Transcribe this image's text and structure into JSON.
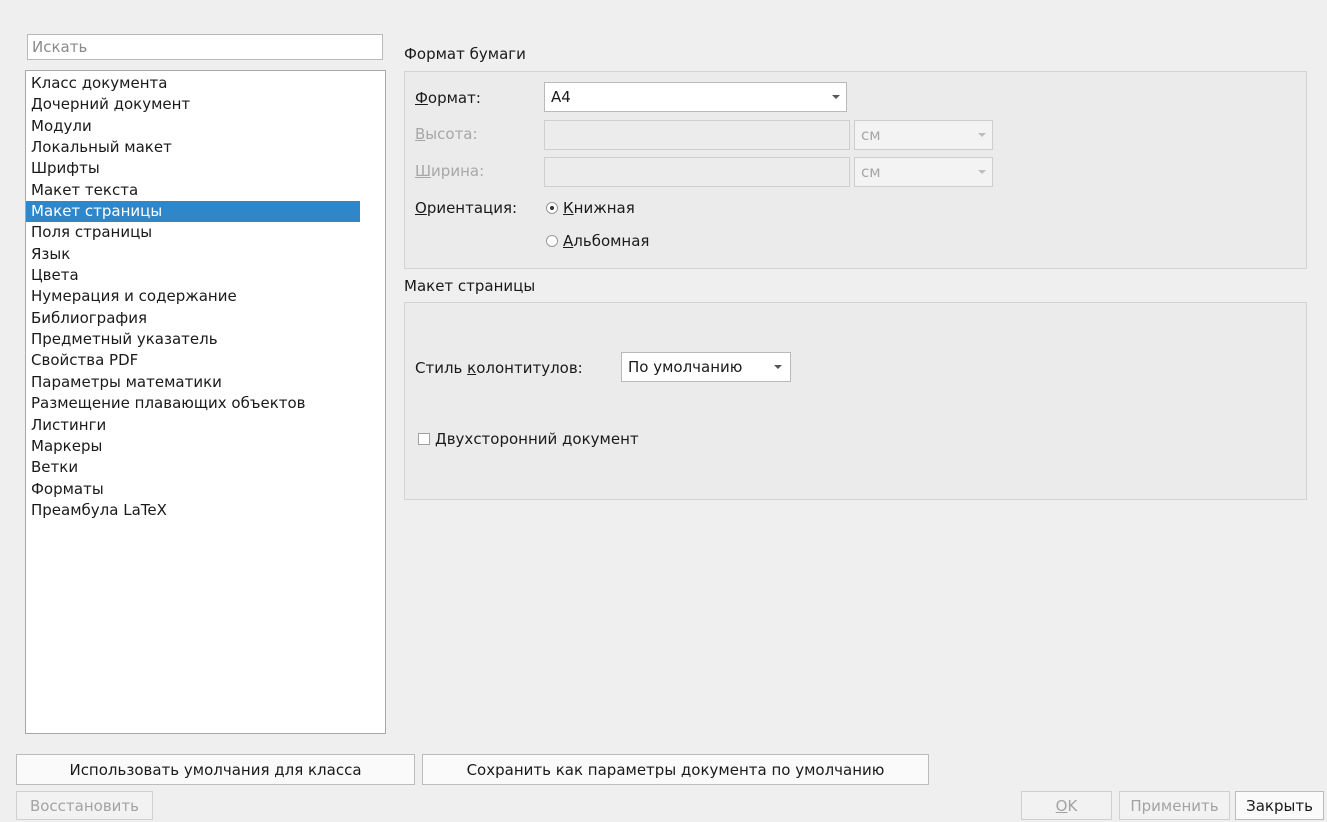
{
  "search": {
    "placeholder": "Искать"
  },
  "nav": {
    "items": [
      "Класс документа",
      "Дочерний документ",
      "Модули",
      "Локальный макет",
      "Шрифты",
      "Макет текста",
      "Макет страницы",
      "Поля страницы",
      "Язык",
      "Цвета",
      "Нумерация и содержание",
      "Библиография",
      "Предметный указатель",
      "Свойства PDF",
      "Параметры математики",
      "Размещение плавающих объектов",
      "Листинги",
      "Маркеры",
      "Ветки",
      "Форматы",
      "Преамбула LaTeX"
    ],
    "selected": "Макет страницы"
  },
  "paper": {
    "section_title": "Формат бумаги",
    "format": {
      "label_u": "Ф",
      "label_rest": "ормат:",
      "value": "A4"
    },
    "height": {
      "label_u": "В",
      "label_rest": "ысота:",
      "value": "",
      "unit": "см"
    },
    "width": {
      "label_u": "Ш",
      "label_rest": "ирина:",
      "value": "",
      "unit": "см"
    },
    "orientation": {
      "label_u": "О",
      "label_rest": "риентация:",
      "portrait": {
        "label_u": "К",
        "label_rest": "нижная",
        "checked": true
      },
      "landscape": {
        "label_u": "А",
        "label_rest": "льбомная",
        "checked": false
      }
    }
  },
  "layout": {
    "section_title": "Макет страницы",
    "header_style": {
      "label_pre": "Стиль ",
      "label_u": "к",
      "label_rest": "олонтитулов:",
      "value": "По умолчанию"
    },
    "two_sided": {
      "label_u": "Д",
      "label_rest": "вухсторонний документ",
      "checked": false
    }
  },
  "buttons": {
    "use_class_defaults": "Использовать умолчания для класса",
    "save_as_defaults": "Сохранить как параметры документа по умолчанию",
    "restore": "Восстановить",
    "ok_u": "O",
    "ok_rest": "K",
    "apply": "Применить",
    "close": "Закрыть"
  }
}
